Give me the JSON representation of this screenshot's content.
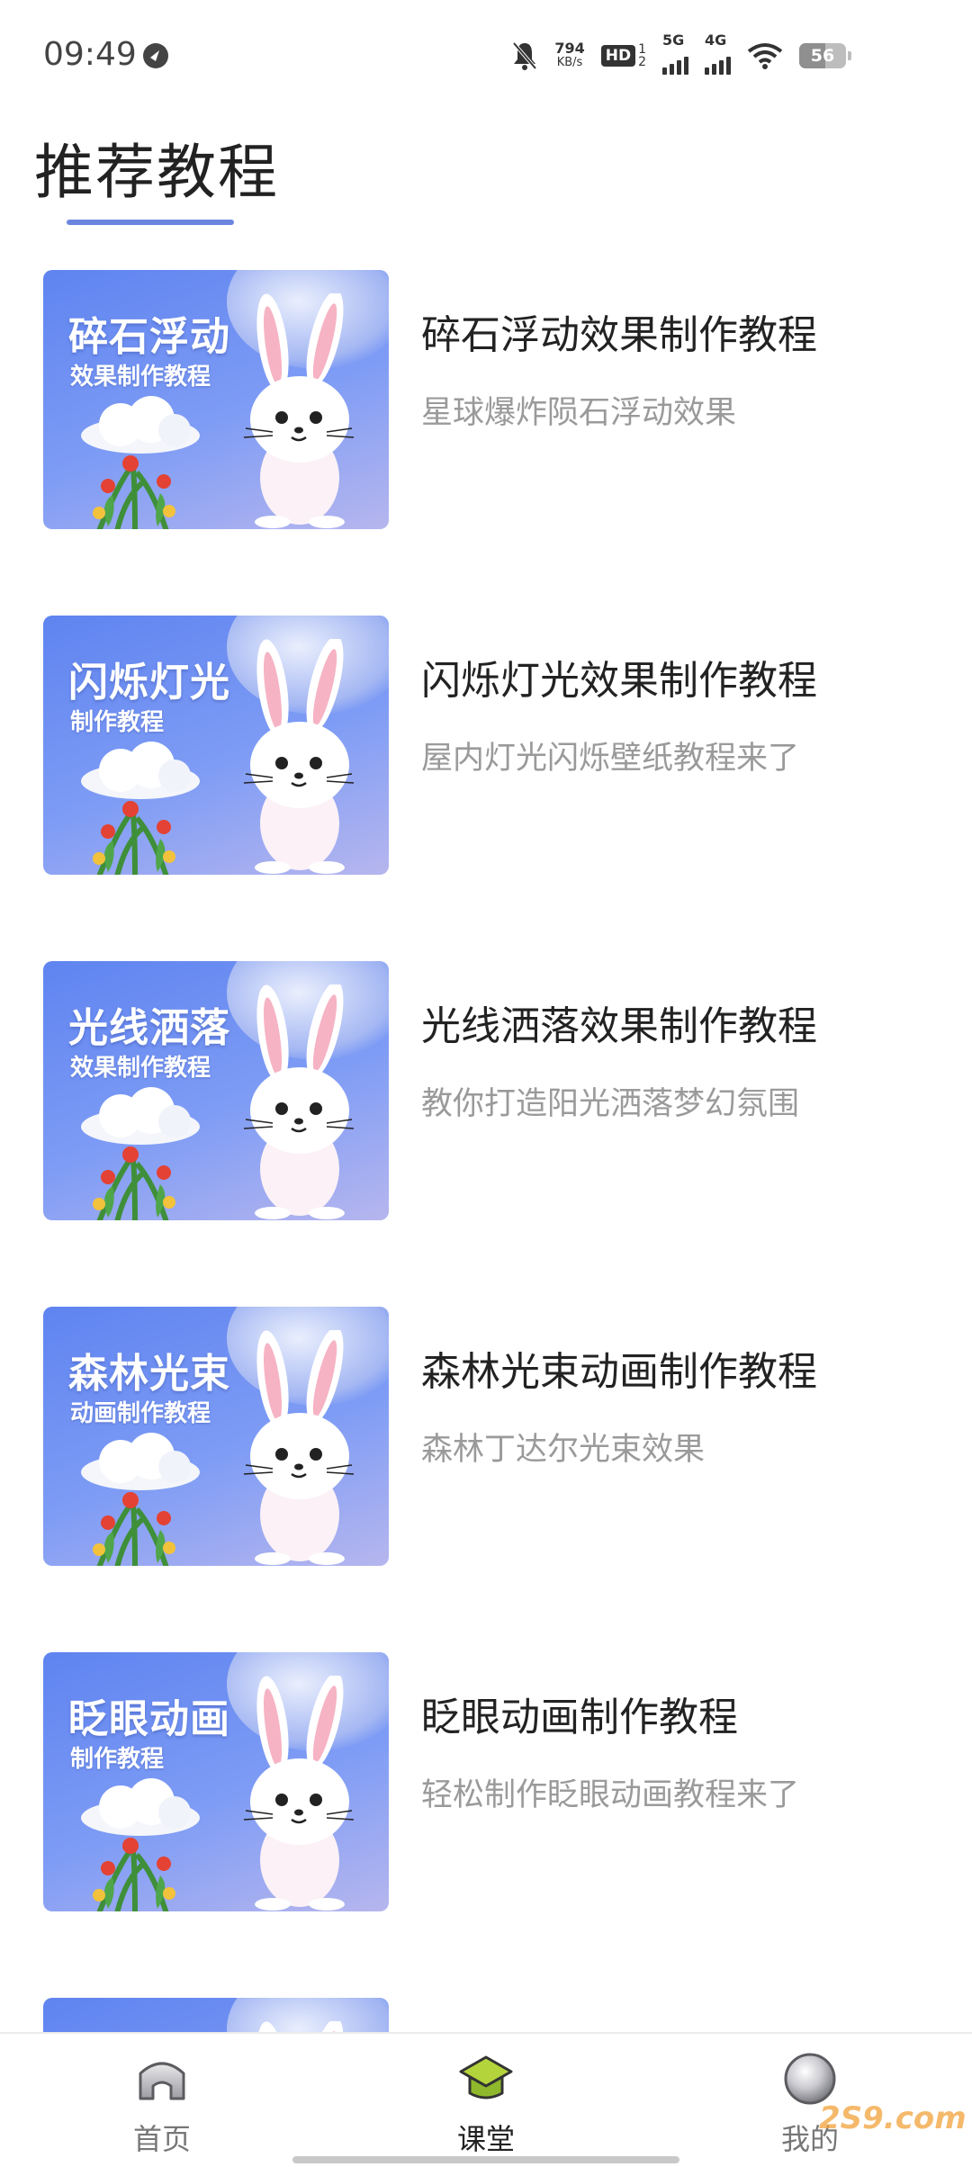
{
  "status_bar": {
    "time": "09:49",
    "net_speed": "794",
    "net_speed_unit": "KB/s",
    "hd": "HD",
    "sim1": "1",
    "sim2": "2",
    "network_1": "5G",
    "network_2": "4G",
    "battery": "56",
    "battery_level": 0.56,
    "icons": [
      "compass-icon",
      "mute-bell-icon",
      "wifi-icon",
      "battery-icon"
    ]
  },
  "page": {
    "title": "推荐教程"
  },
  "courses": [
    {
      "thumb_title": "碎石浮动",
      "thumb_subtitle": "效果制作教程",
      "title": "碎石浮动效果制作教程",
      "subtitle": "星球爆炸陨石浮动效果"
    },
    {
      "thumb_title": "闪烁灯光",
      "thumb_subtitle": "制作教程",
      "title": "闪烁灯光效果制作教程",
      "subtitle": "屋内灯光闪烁壁纸教程来了"
    },
    {
      "thumb_title": "光线洒落",
      "thumb_subtitle": "效果制作教程",
      "title": "光线洒落效果制作教程",
      "subtitle": "教你打造阳光洒落梦幻氛围"
    },
    {
      "thumb_title": "森林光束",
      "thumb_subtitle": "动画制作教程",
      "title": "森林光束动画制作教程",
      "subtitle": "森林丁达尔光束效果"
    },
    {
      "thumb_title": "眨眼动画",
      "thumb_subtitle": "制作教程",
      "title": "眨眼动画制作教程",
      "subtitle": "轻松制作眨眼动画教程来了"
    },
    {
      "thumb_title": "",
      "thumb_subtitle": "",
      "title": "",
      "subtitle": ""
    }
  ],
  "bottom_nav": {
    "items": [
      {
        "label": "首页",
        "icon": "home-icon",
        "active": false
      },
      {
        "label": "课堂",
        "icon": "graduation-cap-icon",
        "active": true
      },
      {
        "label": "我的",
        "icon": "profile-orb-icon",
        "active": false
      }
    ]
  },
  "watermark": "2S9.com",
  "colors": {
    "accent": "#6a86df",
    "thumb_gradient_start": "#5f84f0",
    "thumb_gradient_end": "#b6b6ee",
    "title_text": "#222222",
    "subtitle_text": "#9a9a9a",
    "active_icon_green": "#b4d43c"
  }
}
